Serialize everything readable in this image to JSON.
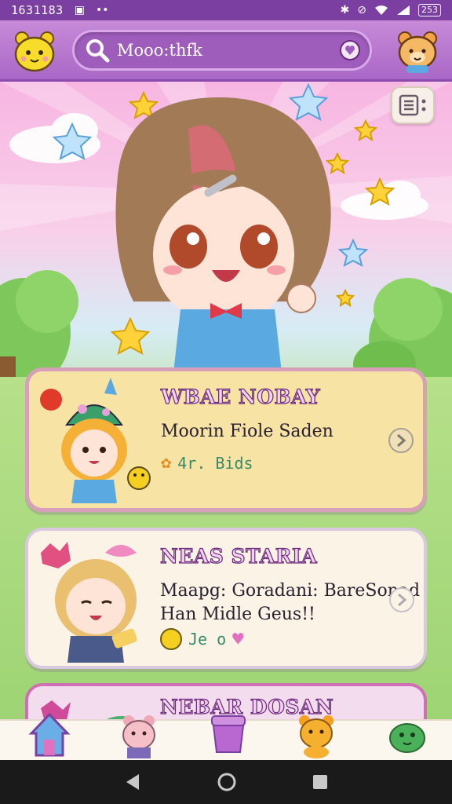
{
  "status": {
    "time": "1631183",
    "right_icons": [
      "bluetooth-icon",
      "alarm-icon",
      "wifi-icon",
      "signal-icon"
    ],
    "battery": "253"
  },
  "header": {
    "search_text": "Mooo:thfk"
  },
  "cards": [
    {
      "title": "WBAE NOBAY",
      "subtitle": "Moorin Fiole Saden",
      "meta": "4r. Bids"
    },
    {
      "title": "NEAS STARIA",
      "subtitle_line1": "Maapg: Goradani: BareSonad",
      "subtitle_line2": "Han Midle Geus!!",
      "meta": "Je o"
    },
    {
      "title": "NEBAR DOSAN"
    }
  ],
  "colors": {
    "topbar": "#a968c6",
    "card_highlight_bg": "#f7e3a4",
    "card_bg": "#fbf4e6",
    "title_stroke": "#6b2a7c"
  }
}
